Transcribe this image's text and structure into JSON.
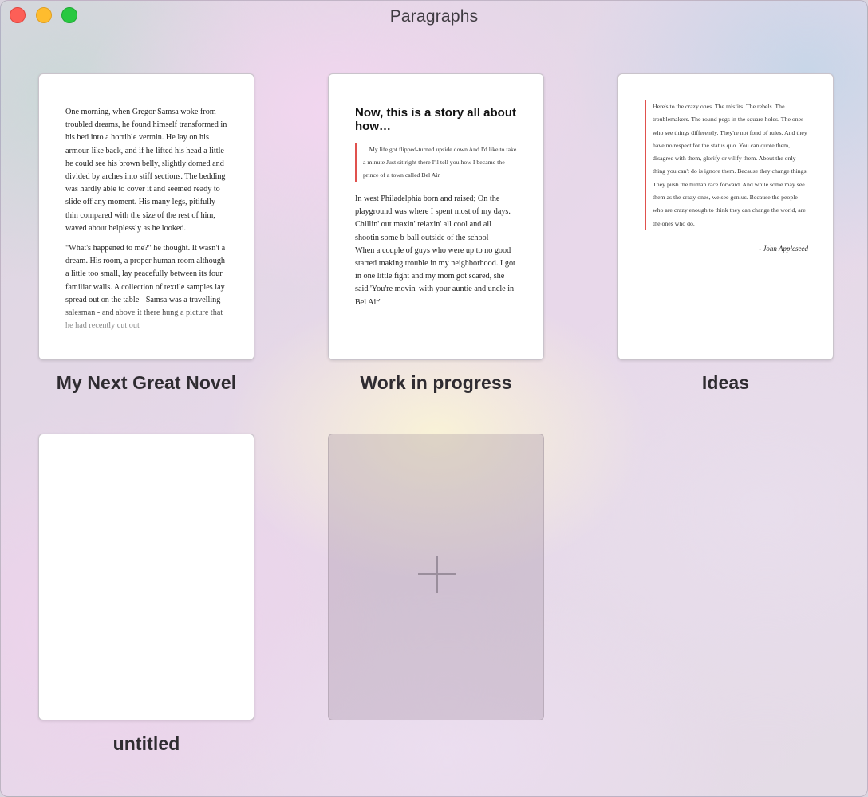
{
  "window": {
    "title": "Paragraphs"
  },
  "documents": [
    {
      "name": "My Next Great Novel",
      "paragraphs": [
        "One morning, when Gregor Samsa woke from troubled dreams, he found himself transformed in his bed into a horrible vermin. He lay on his armour-like back, and if he lifted his head a little he could see his brown belly, slightly domed and divided by arches into stiff sections. The bedding was hardly able to cover it and seemed ready to slide off any moment. His many legs, pitifully thin compared with the size of the rest of him, waved about helplessly as he looked.",
        "\"What's happened to me?\" he thought. It wasn't a dream. His room, a proper human room although a little too small, lay peacefully between its four familiar walls. A collection of textile samples lay spread out on the table - Samsa was a travelling salesman - and above it there hung a picture that he had recently cut out"
      ]
    },
    {
      "name": "Work in progress",
      "heading": "Now, this is a story all about how…",
      "quote": "…My life got flipped-turned upside down And I'd like to take a minute Just sit right there I'll tell you how I became the prince of a town called Bel Air",
      "paragraph": "In west Philadelphia born and raised; On the playground was where I spent most of my days. Chillin' out maxin' relaxin' all cool and all shootin some b-ball outside of the school - - When a couple of guys who were up to no good started making trouble in my neighborhood. I got in one little fight and my mom got scared, she said 'You're movin' with your auntie and uncle in Bel Air'"
    },
    {
      "name": "Ideas",
      "quote": "Here's to the crazy ones. The misfits. The rebels. The troublemakers. The round pegs in the square holes. The ones who see things differently. They're not fond of rules. And they have no respect for the status quo. You can quote them, disagree with them, glorify or vilify them. About the only thing you can't do is ignore them. Because they change things. They push the human race forward. And while some may see them as the crazy ones, we see genius. Because the people who are crazy enough to think they can change the world, are the ones who do.",
      "attribution": "- John Appleseed"
    },
    {
      "name": "untitled"
    }
  ],
  "add_document": {
    "icon": "plus-icon"
  }
}
